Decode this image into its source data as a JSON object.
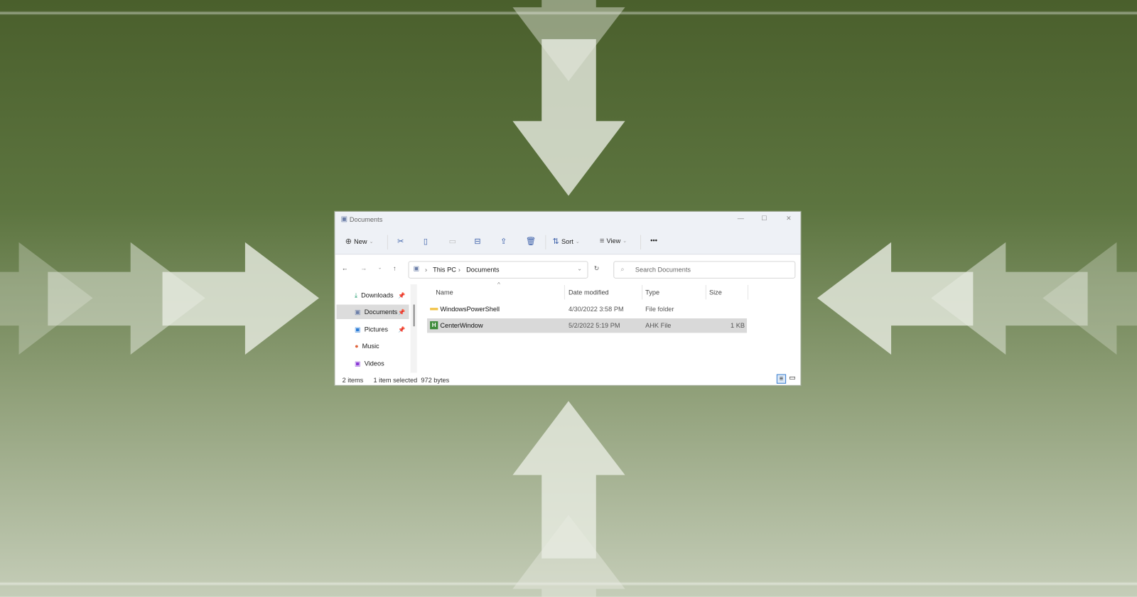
{
  "window": {
    "title": "Documents",
    "minimize": "—",
    "maximize": "☐",
    "close": "✕"
  },
  "toolbar": {
    "new": "New",
    "sort": "Sort",
    "view": "View",
    "more": "•••"
  },
  "address": {
    "segments": [
      "This PC",
      "Documents"
    ],
    "search_placeholder": "Search Documents"
  },
  "nav": [
    {
      "label": "Downloads",
      "icon": "download-icon",
      "pinned": true
    },
    {
      "label": "Documents",
      "icon": "documents-icon",
      "pinned": true,
      "selected": true
    },
    {
      "label": "Pictures",
      "icon": "pictures-icon",
      "pinned": true
    },
    {
      "label": "Music",
      "icon": "music-icon",
      "pinned": false
    },
    {
      "label": "Videos",
      "icon": "videos-icon",
      "pinned": false
    }
  ],
  "columns": [
    "Name",
    "Date modified",
    "Type",
    "Size"
  ],
  "files": [
    {
      "name": "WindowsPowerShell",
      "date": "4/30/2022 3:58 PM",
      "type": "File folder",
      "size": ""
    },
    {
      "name": "CenterWindow",
      "date": "5/2/2022 5:19 PM",
      "type": "AHK File",
      "size": "1 KB",
      "selected": true
    }
  ],
  "status": {
    "count": "2 items",
    "selection": "1 item selected  972 bytes"
  },
  "colors": {
    "selected_row": "#d9d9d9",
    "accent": "#0067c0"
  }
}
